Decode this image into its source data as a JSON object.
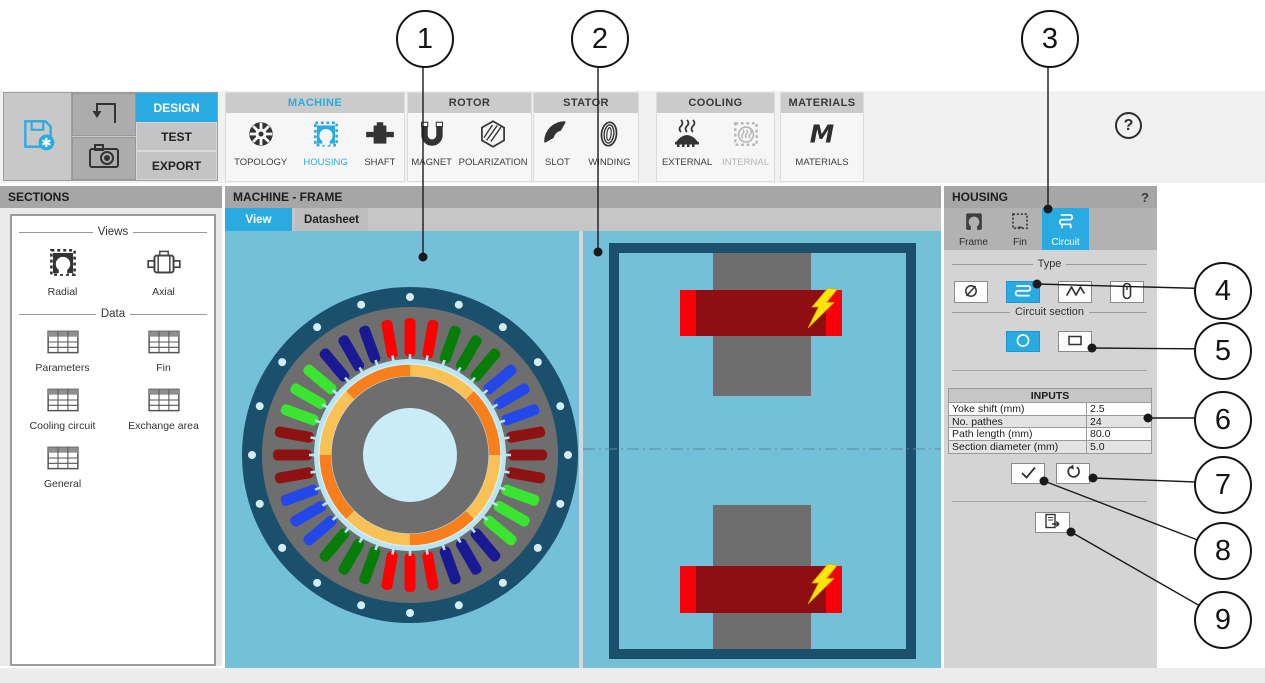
{
  "header": {
    "design": "DESIGN",
    "test": "TEST",
    "export": "EXPORT",
    "help": "?"
  },
  "ribbon": {
    "groups": [
      {
        "title": "MACHINE",
        "items": [
          {
            "label": "TOPOLOGY"
          },
          {
            "label": "HOUSING"
          },
          {
            "label": "SHAFT"
          }
        ]
      },
      {
        "title": "ROTOR",
        "items": [
          {
            "label": "MAGNET"
          },
          {
            "label": "POLARIZATION"
          }
        ]
      },
      {
        "title": "STATOR",
        "items": [
          {
            "label": "SLOT"
          },
          {
            "label": "WINDING"
          }
        ]
      },
      {
        "title": "COOLING",
        "items": [
          {
            "label": "EXTERNAL"
          },
          {
            "label": "INTERNAL"
          }
        ]
      },
      {
        "title": "MATERIALS",
        "items": [
          {
            "label": "MATERIALS"
          }
        ]
      }
    ]
  },
  "sections": {
    "title": "SECTIONS",
    "views_label": "Views",
    "radial": "Radial",
    "axial": "Axial",
    "data_label": "Data",
    "parameters": "Parameters",
    "fin": "Fin",
    "cooling_circuit": "Cooling circuit",
    "exchange_area": "Exchange area",
    "general": "General"
  },
  "main": {
    "title": "MACHINE - FRAME",
    "tab_view": "View",
    "tab_datasheet": "Datasheet"
  },
  "housing": {
    "title": "HOUSING",
    "help": "?",
    "tab_frame": "Frame",
    "tab_fin": "Fin",
    "tab_circuit": "Circuit",
    "type_label": "Type",
    "circuit_section_label": "Circuit section",
    "inputs_title": "INPUTS",
    "inputs": [
      {
        "label": "Yoke shift (mm)",
        "value": "2.5"
      },
      {
        "label": "No. pathes",
        "value": "24"
      },
      {
        "label": "Path length (mm)",
        "value": "80.0"
      },
      {
        "label": "Section diameter (mm)",
        "value": "5.0"
      }
    ]
  },
  "callouts": [
    "1",
    "2",
    "3",
    "4",
    "5",
    "6",
    "7",
    "8",
    "9"
  ],
  "colors": {
    "accent": "#29abe2",
    "canvas": "#74c0d8",
    "frame": "#1a506b",
    "stator": "#6e6e6e",
    "shaft": "#c9ecf8",
    "airgap": "#b9e5f2",
    "bolt_hole": "#d2edf7",
    "magnet_a": "#fcc155",
    "magnet_b": "#f87f1b",
    "coil_end": "#f60309",
    "coil_slot": "#8f0e12",
    "lightning": "#ffe608",
    "centerline": "#5b8a9b"
  },
  "radial_view": {
    "slot_count": 36,
    "slots_per_belt": 3,
    "slot_color_cycle": [
      "#fe0000",
      "#067d06",
      "#2347e8",
      "#8e1212",
      "#3ae532",
      "#191993"
    ],
    "pole_count": 8,
    "bolt_count": 20
  }
}
